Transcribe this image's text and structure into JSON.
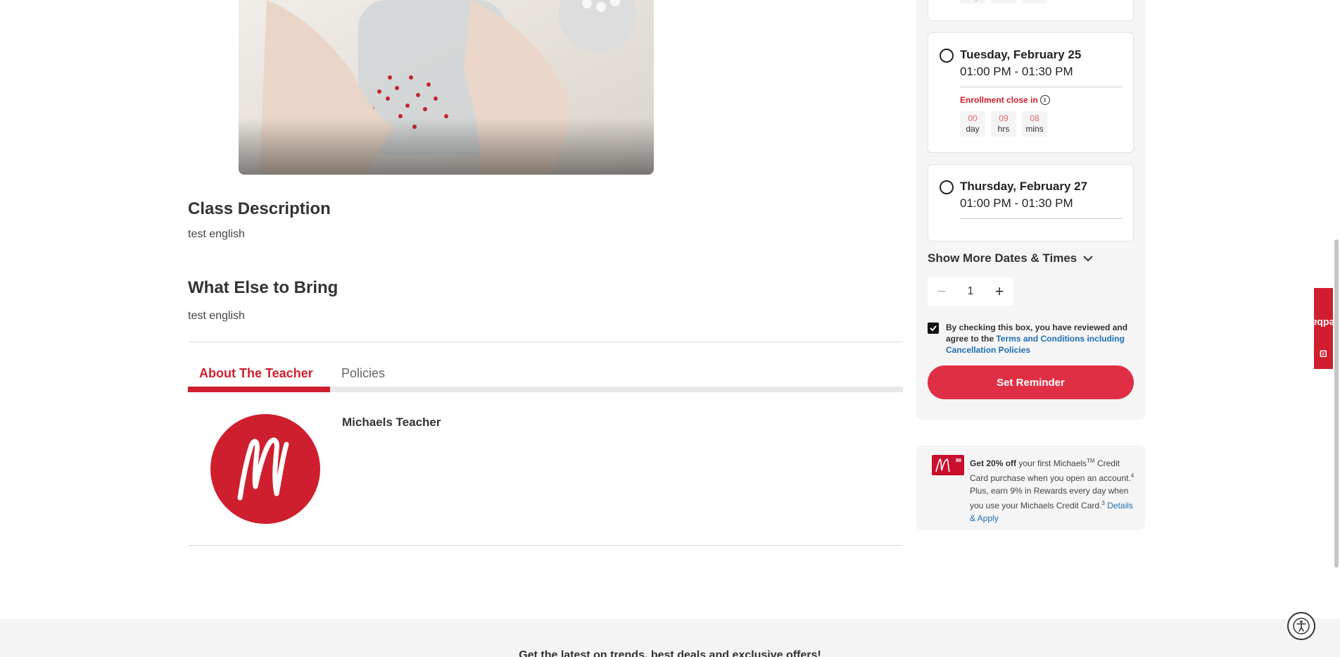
{
  "class_description": {
    "title": "Class Description",
    "text": "test english"
  },
  "what_else": {
    "title": "What Else to Bring",
    "text": "test english"
  },
  "tabs": [
    {
      "label": "About The Teacher",
      "active": true
    },
    {
      "label": "Policies",
      "active": false
    }
  ],
  "teacher": {
    "name": "Michaels Teacher",
    "avatar_letter": "M"
  },
  "sessions": [
    {
      "date": "Tuesday, February 25",
      "time": "01:00 PM - 01:30 PM",
      "enrollment_label": "Enrollment close in",
      "countdown": [
        {
          "value": "00",
          "unit": "day"
        },
        {
          "value": "09",
          "unit": "hrs"
        },
        {
          "value": "08",
          "unit": "mins"
        }
      ]
    },
    {
      "date": "Thursday, February 27",
      "time": "01:00 PM - 01:30 PM"
    }
  ],
  "partial_countdown_units": [
    "day",
    "hrs",
    "mins"
  ],
  "show_more": "Show More Dates & Times",
  "quantity": {
    "value": "1",
    "minus": "−",
    "plus": "+"
  },
  "agreement": {
    "text": "By checking this box, you have reviewed and agree to the ",
    "link": "Terms and Conditions including Cancellation Policies",
    "checked": true
  },
  "reminder_button": "Set Reminder",
  "credit": {
    "bold": "Get 20% off",
    "text1": " your first Michaels",
    "tm": "TM",
    "text2": " Credit Card purchase when you open an account.",
    "sup4": "4",
    "text3": " Plus, earn 9% in Rewards every day when you use your Michaels Credit Card.",
    "sup3": "3",
    "link": "Details & Apply"
  },
  "feedback": "Feedback",
  "footer_text": "Get the latest on trends, best deals and exclusive offers!",
  "colors": {
    "brand_red": "#cf1f2e",
    "button_red": "#e02f45",
    "link_blue": "#1a6fb5"
  }
}
